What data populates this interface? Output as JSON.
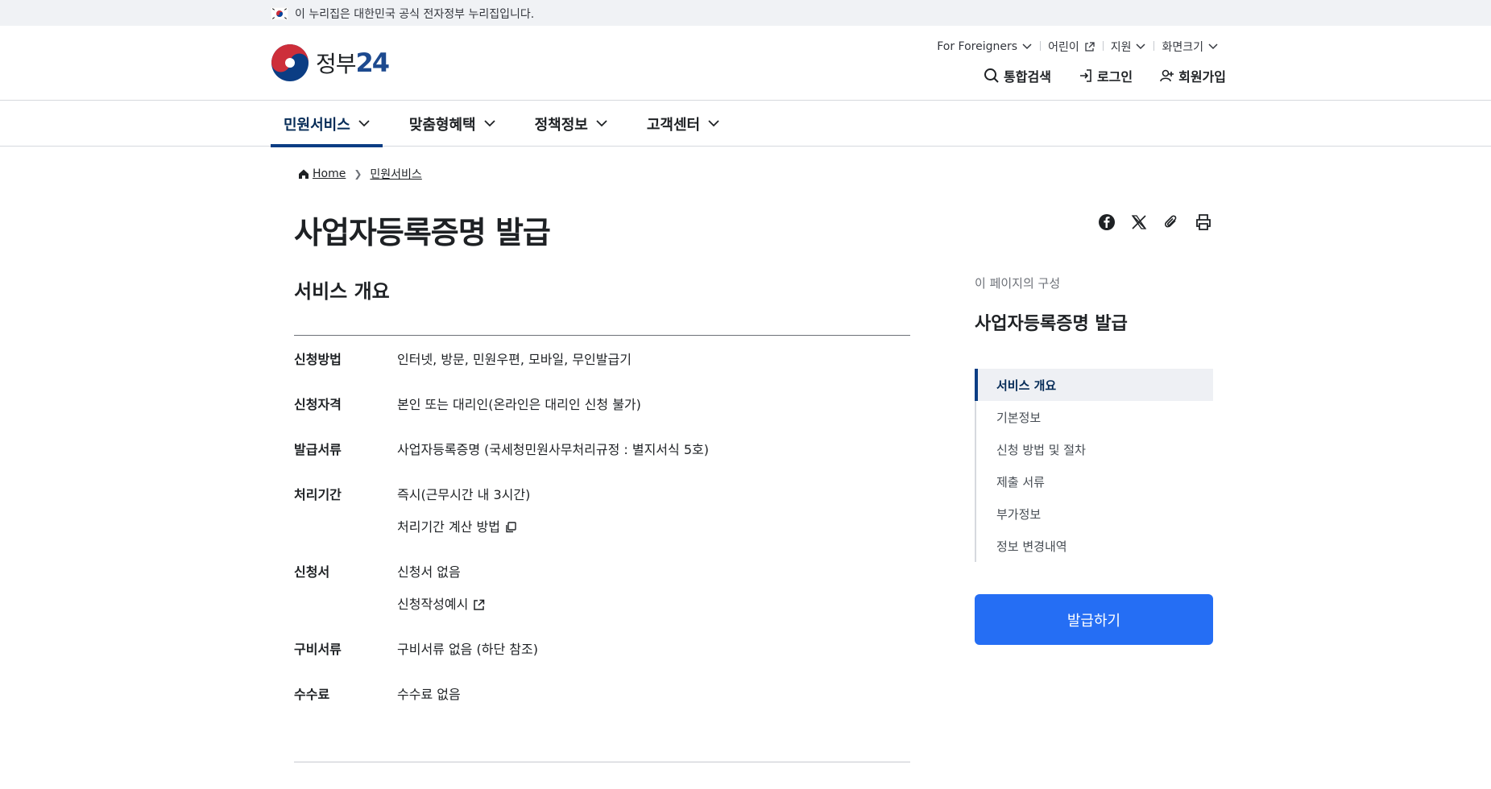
{
  "banner": {
    "text": "이 누리집은 대한민국 공식 전자정부 누리집입니다."
  },
  "logo": {
    "text": "정부",
    "num": "24"
  },
  "utility": {
    "items": [
      "For Foreigners",
      "어린이",
      "지원",
      "화면크기"
    ]
  },
  "actions": {
    "search": "통합검색",
    "login": "로그인",
    "signup": "회원가입"
  },
  "gnb": {
    "items": [
      "민원서비스",
      "맞춤형혜택",
      "정책정보",
      "고객센터"
    ]
  },
  "breadcrumb": {
    "home": "Home",
    "current": "민원서비스"
  },
  "page": {
    "title": "사업자등록증명 발급"
  },
  "overview": {
    "title": "서비스 개요",
    "rows": [
      {
        "label": "신청방법",
        "value": "인터넷, 방문, 민원우편, 모바일, 무인발급기"
      },
      {
        "label": "신청자격",
        "value": "본인 또는 대리인(온라인은 대리인 신청 불가)"
      },
      {
        "label": "발급서류",
        "value": "사업자등록증명 (국세청민원사무처리규정 : 별지서식 5호)"
      },
      {
        "label": "처리기간",
        "value": "즉시(근무시간 내 3시간)",
        "link": "처리기간 계산 방법"
      },
      {
        "label": "신청서",
        "value": "신청서 없음",
        "link": "신청작성예시"
      },
      {
        "label": "구비서류",
        "value": "구비서류 없음 (하단 참조)"
      },
      {
        "label": "수수료",
        "value": "수수료 없음"
      }
    ]
  },
  "toc": {
    "caption": "이 페이지의 구성",
    "title": "사업자등록증명 발급",
    "items": [
      "서비스 개요",
      "기본정보",
      "신청 방법 및 절차",
      "제출 서류",
      "부가정보",
      "정보 변경내역"
    ]
  },
  "cta": {
    "label": "발급하기"
  },
  "colors": {
    "primary": "#256ef4",
    "navy": "#0b3d84"
  }
}
